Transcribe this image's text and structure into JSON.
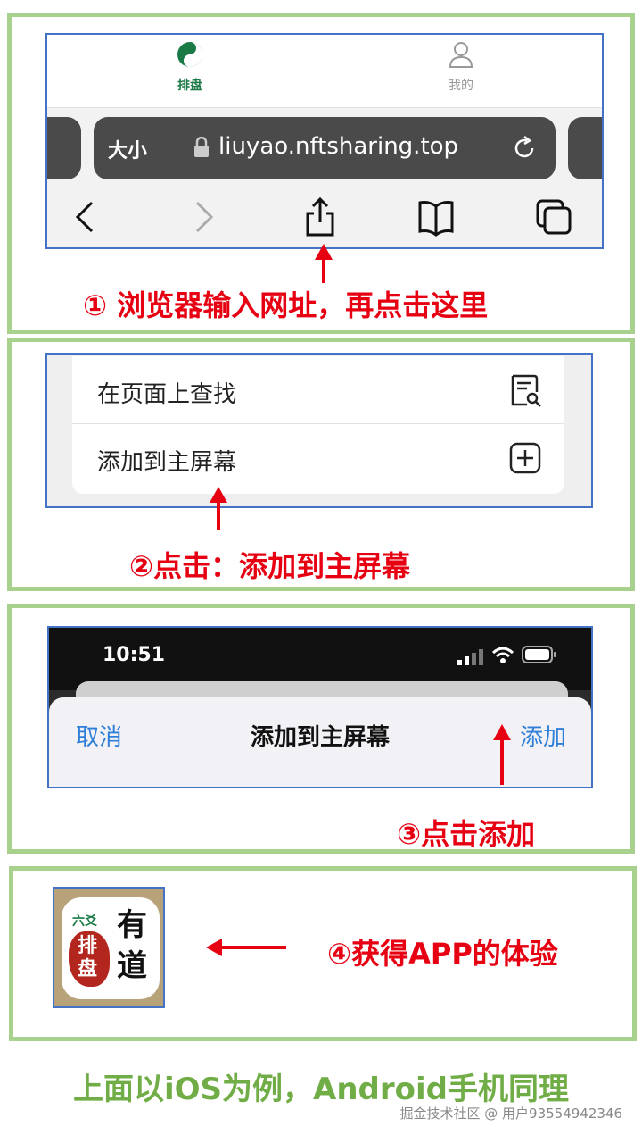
{
  "step1": {
    "tabs": [
      {
        "label": "排盘",
        "icon": "taichi-icon",
        "color": "#1a7a45"
      },
      {
        "label": "我的",
        "icon": "person-icon",
        "color": "#999999"
      }
    ],
    "size_label": "大小",
    "url": "liuyao.nftsharing.top",
    "caption": "① 浏览器输入网址，再点击这里"
  },
  "step2": {
    "menu": [
      {
        "label": "在页面上查找",
        "icon": "find-on-page-icon"
      },
      {
        "label": "添加到主屏幕",
        "icon": "add-square-icon"
      }
    ],
    "caption": "②点击：添加到主屏幕"
  },
  "step3": {
    "time": "10:51",
    "cancel": "取消",
    "title": "添加到主屏幕",
    "add": "添加",
    "caption": "③点击添加"
  },
  "step4": {
    "app_small": "六爻",
    "app_seal": "排盘",
    "app_big": "有道",
    "caption": "④获得APP的体验"
  },
  "footer": "上面以iOS为例，Android手机同理",
  "watermark": "掘金技术社区 @ 用户93554942346",
  "colors": {
    "accent_red": "#e60012",
    "panel_border": "#a9d18e",
    "shot_border": "#4472c4",
    "link_blue": "#2f7fd8",
    "footer_green": "#70ad47"
  }
}
